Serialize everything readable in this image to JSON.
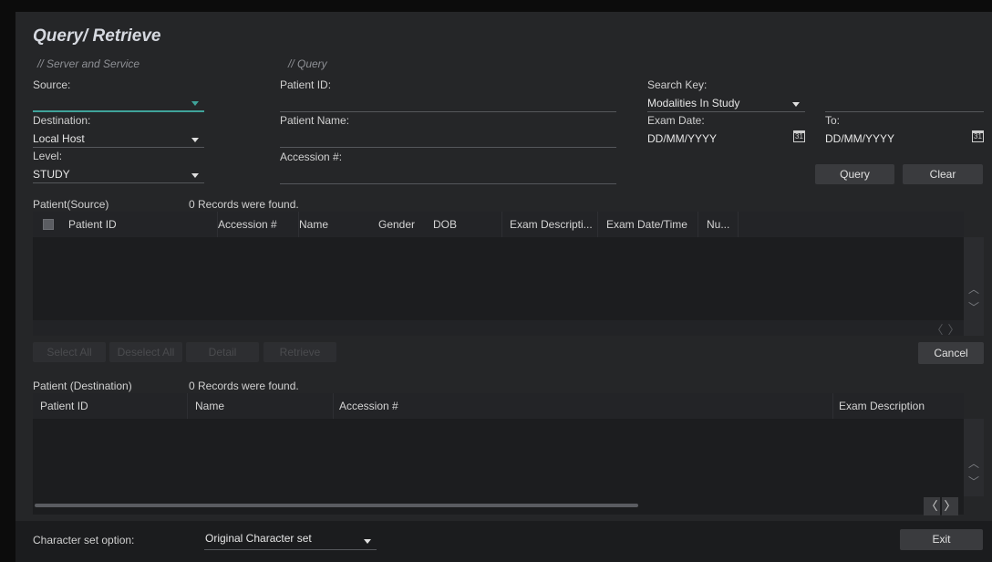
{
  "title": "Query/ Retrieve",
  "sections": {
    "server": "// Server and Service",
    "query": "// Query"
  },
  "server": {
    "source_label": "Source:",
    "source_value": "",
    "destination_label": "Destination:",
    "destination_value": "Local Host",
    "level_label": "Level:",
    "level_value": "STUDY"
  },
  "query": {
    "patient_id_label": "Patient ID:",
    "patient_name_label": "Patient Name:",
    "accession_label": "Accession #:"
  },
  "search": {
    "search_key_label": "Search Key:",
    "search_key_value": "Modalities In Study",
    "exam_date_label": "Exam Date:",
    "exam_date_from": "DD/MM/YYYY",
    "to_label": "To:",
    "exam_date_to": "DD/MM/YYYY",
    "calendar_glyph": "31"
  },
  "buttons": {
    "query": "Query",
    "clear": "Clear",
    "select_all": "Select All",
    "deselect_all": "Deselect All",
    "detail": "Detail",
    "retrieve": "Retrieve",
    "cancel": "Cancel",
    "exit": "Exit"
  },
  "source_table": {
    "label": "Patient(Source)",
    "records": "0 Records were found.",
    "columns": [
      "Patient ID",
      "Accession #",
      "Name",
      "Gender",
      "DOB",
      "Exam Descripti...",
      "Exam Date/Time",
      "Nu..."
    ]
  },
  "dest_table": {
    "label": "Patient (Destination)",
    "records": "0 Records were found.",
    "columns": [
      "Patient ID",
      "Name",
      "Accession #",
      "Exam Description"
    ]
  },
  "charset": {
    "label": "Character set option:",
    "value": "Original Character set"
  },
  "icons": {
    "up": "︿",
    "down": "﹀",
    "left": "〈",
    "right": "〉"
  },
  "colors": {
    "accent": "#3fa39a",
    "panel": "#252628",
    "grid": "#1c1d1f"
  }
}
